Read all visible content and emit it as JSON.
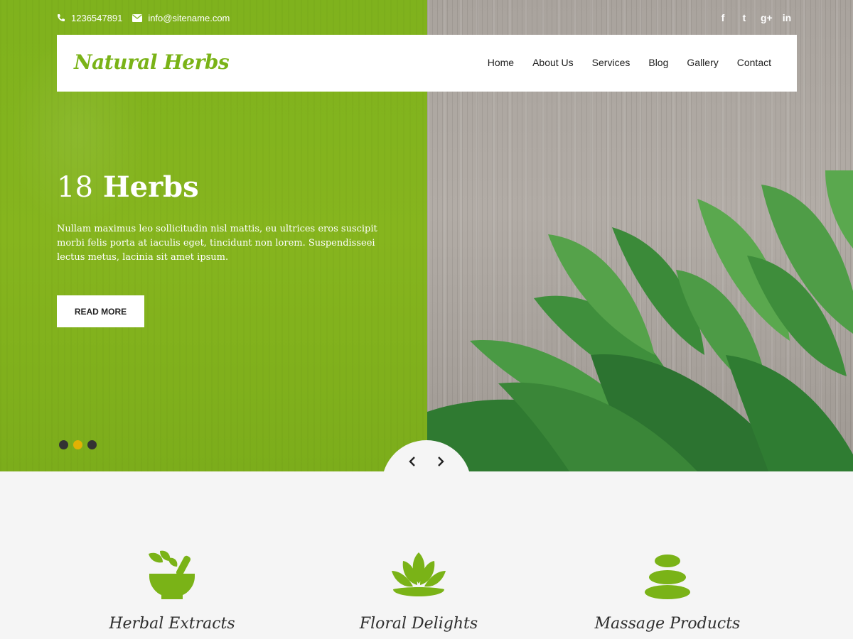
{
  "topbar": {
    "phone": "1236547891",
    "email": "info@sitename.com",
    "social": [
      "facebook-icon",
      "twitter-icon",
      "google-plus-icon",
      "linkedin-icon"
    ],
    "social_glyphs": [
      "f",
      "t",
      "g+",
      "in"
    ]
  },
  "header": {
    "logo": "Natural Herbs",
    "menu": [
      "Home",
      "About Us",
      "Services",
      "Blog",
      "Gallery",
      "Contact"
    ]
  },
  "slider": {
    "title_number": "18",
    "title_word": "Herbs",
    "description": "Nullam maximus leo sollicitudin nisl mattis, eu ultrices eros suscipit morbi felis porta at iaculis eget, tincidunt non lorem. Suspendisseei lectus metus, lacinia sit amet ipsum.",
    "button": "READ MORE",
    "slides": 3,
    "active_slide": 2
  },
  "features": [
    {
      "title": "Herbal Extracts",
      "icon": "mortar-pestle-icon"
    },
    {
      "title": "Floral Delights",
      "icon": "lotus-icon"
    },
    {
      "title": "Massage Products",
      "icon": "spa-stones-icon"
    }
  ],
  "colors": {
    "accent": "#7ab317",
    "dot_active": "#e2b104",
    "dot_inactive": "#333333"
  }
}
